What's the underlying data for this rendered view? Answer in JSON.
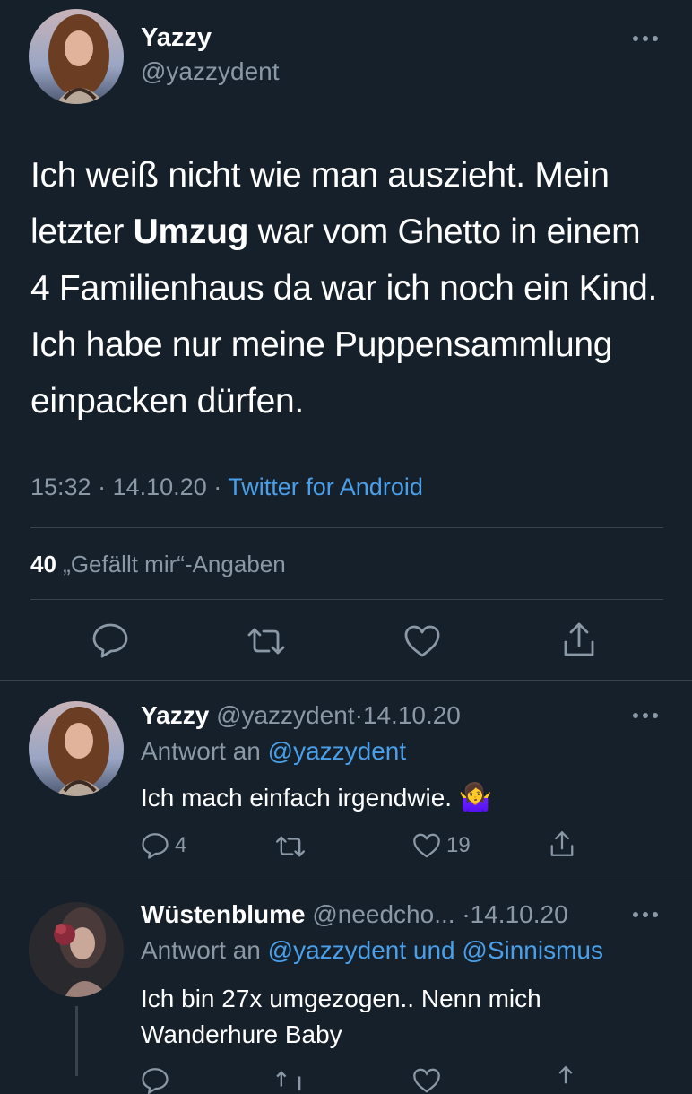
{
  "main_tweet": {
    "author_name": "Yazzy",
    "handle": "@yazzydent",
    "text_part1": "Ich weiß nicht wie man auszieht. Mein letzter ",
    "text_bold": "Umzug",
    "text_part2": " war vom Ghetto in einem 4 Familienhaus da war ich noch ein Kind. Ich habe nur meine Puppensammlung einpacken dürfen.",
    "time": "15:32",
    "date": "14.10.20",
    "separator": "·",
    "source": "Twitter for Android",
    "likes_count": "40",
    "likes_label": "„Gefällt mir“-Angaben",
    "actions": [
      "reply-icon",
      "retweet-icon",
      "like-icon",
      "share-icon"
    ]
  },
  "replies": [
    {
      "author_name": "Yazzy",
      "handle": "@yazzydent",
      "separator": "·",
      "date": "14.10.20",
      "reply_to_prefix": "Antwort an",
      "reply_to": "@yazzydent",
      "text": "Ich mach einfach irgendwie.",
      "emoji": "🤷‍♀️",
      "reply_count": "4",
      "retweet_count": "",
      "like_count": "19"
    },
    {
      "author_name": "Wüstenblume",
      "handle": "@needcho...",
      "separator": "·",
      "date": "14.10.20",
      "reply_to_prefix": "Antwort an",
      "reply_to": "@yazzydent und @Sinnismus",
      "text": "Ich bin 27x umgezogen.. Nenn mich Wanderhure Baby"
    }
  ],
  "colors": {
    "background": "#15202b",
    "text": "#ffffff",
    "muted": "#8b98a5",
    "link": "#4a9fe8",
    "divider": "#38444d"
  }
}
